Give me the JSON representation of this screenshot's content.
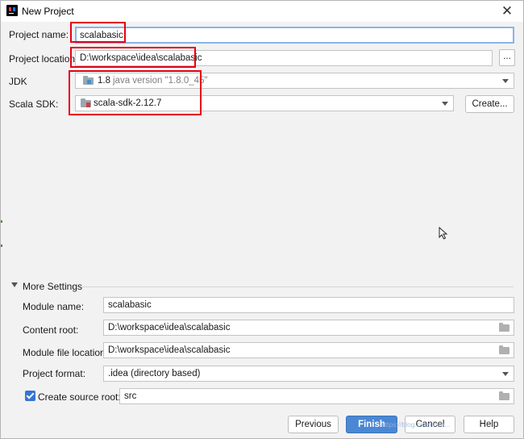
{
  "window": {
    "title": "New Project",
    "close_glyph": "✕"
  },
  "form": {
    "project_name_label": "Project name:",
    "project_name_value": "scalabasic",
    "project_location_label": "Project location:",
    "project_location_value": "D:\\workspace\\idea\\scalabasic",
    "browse_label": "...",
    "jdk_label": "JDK",
    "jdk_value": "1.8",
    "jdk_detail": "java version \"1.8.0_45\"",
    "scala_sdk_label": "Scala SDK:",
    "scala_sdk_value": "scala-sdk-2.12.7",
    "create_label": "Create..."
  },
  "more_settings": {
    "title": "More Settings",
    "module_name_label": "Module name:",
    "module_name_value": "scalabasic",
    "content_root_label": "Content root:",
    "content_root_value": "D:\\workspace\\idea\\scalabasic",
    "module_file_location_label": "Module file location:",
    "module_file_location_value": "D:\\workspace\\idea\\scalabasic",
    "project_format_label": "Project format:",
    "project_format_value": ".idea (directory based)",
    "create_source_root_label": "Create source root:",
    "create_source_root_checked": true,
    "source_root_value": "src"
  },
  "buttons": {
    "previous": "Previous",
    "finish": "Finish",
    "cancel": "Cancel",
    "help": "Help"
  },
  "watermark": "https://blog.csdn.net/...",
  "icons": {
    "app": "intellij-idea-icon",
    "jdk": "jdk-folder-icon",
    "scala": "scala-sdk-icon",
    "browse": "folder-icon"
  },
  "colors": {
    "highlight_box": "#e60012",
    "primary_button": "#4a87d4",
    "focus_border": "#8ab4e8"
  }
}
